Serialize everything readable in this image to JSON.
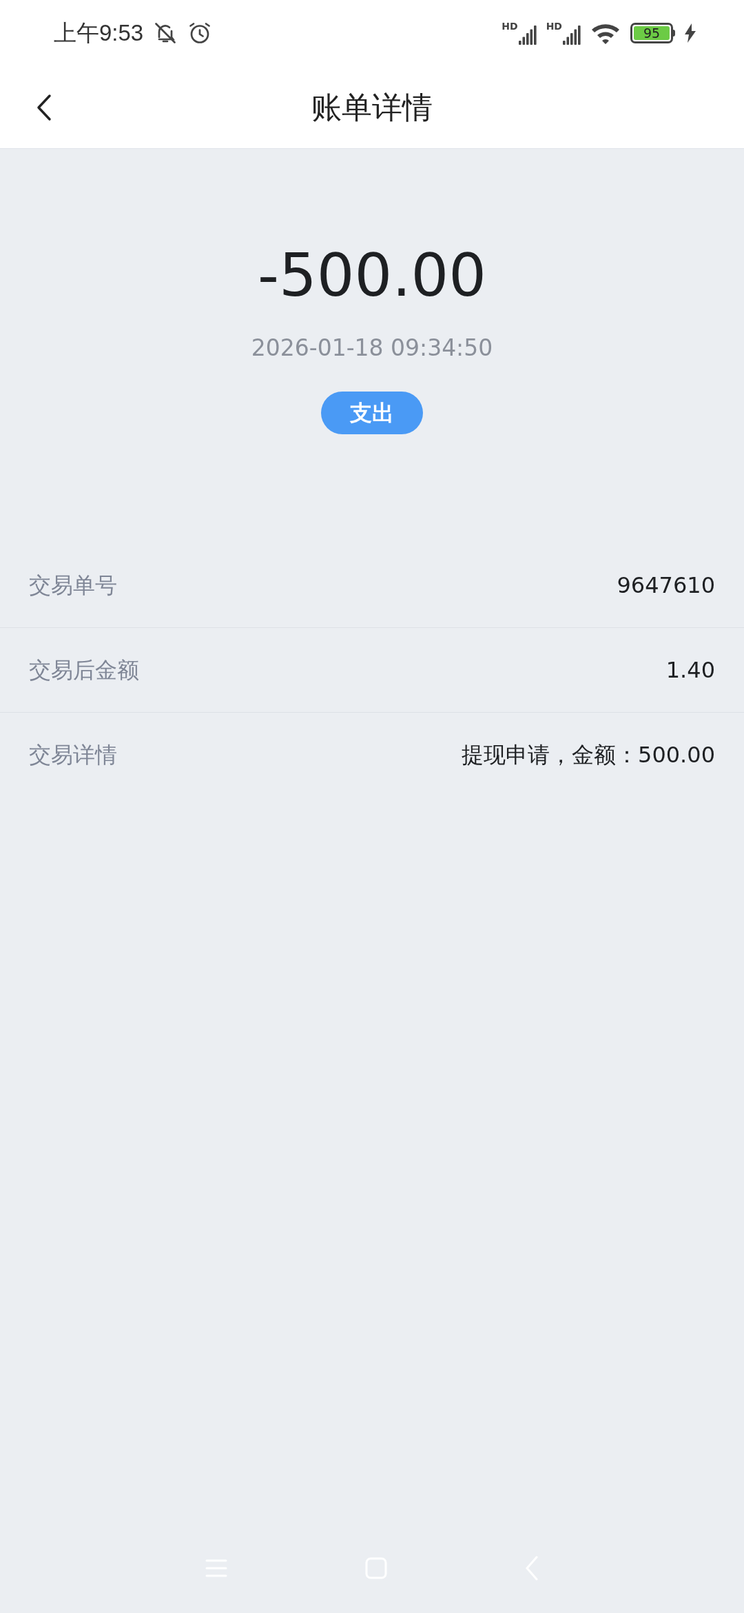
{
  "status_bar": {
    "time": "上午9:53",
    "signal_labels": [
      "HD",
      "HD"
    ],
    "battery": "95"
  },
  "header": {
    "title": "账单详情"
  },
  "summary": {
    "amount": "-500.00",
    "datetime": "2026-01-18 09:34:50",
    "tag": "支出"
  },
  "details": [
    {
      "label": "交易单号",
      "value": "9647610"
    },
    {
      "label": "交易后金额",
      "value": "1.40"
    },
    {
      "label": "交易详情",
      "value": "提现申请，金额：500.00"
    }
  ]
}
